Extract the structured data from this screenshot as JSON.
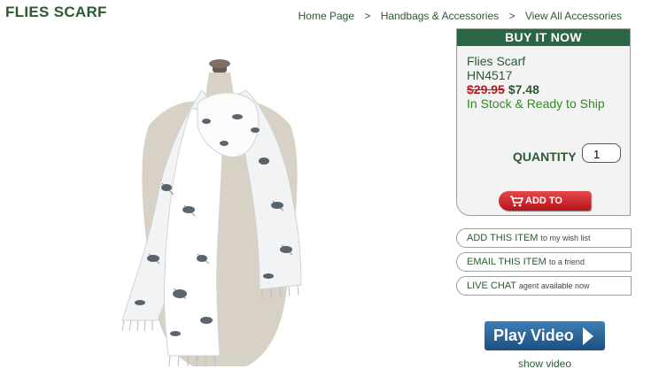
{
  "page": {
    "title": "FLIES SCARF"
  },
  "breadcrumb": {
    "items": [
      "Home Page",
      "Handbags & Accessories",
      "View All Accessories"
    ],
    "separator": ">"
  },
  "buy_box": {
    "header": "BUY IT NOW",
    "product_name": "Flies Scarf",
    "sku": "HN4517",
    "old_price": "$29.95",
    "new_price": "$7.48",
    "stock_status": "In Stock & Ready to Ship",
    "quantity_label": "QUANTITY",
    "quantity_value": "1",
    "add_to_cart_label": "ADD TO CART"
  },
  "links": {
    "wish_main": "ADD THIS ITEM",
    "wish_sub": "to my wish list",
    "email_main": "EMAIL THIS ITEM",
    "email_sub": "to a friend",
    "chat_main": "LIVE CHAT",
    "chat_sub": "agent available now"
  },
  "video": {
    "button_label": "Play Video",
    "caption": "show video"
  },
  "icons": {
    "cart": "cart-icon",
    "play": "play-arrow-icon"
  },
  "colors": {
    "brand_green": "#2b6644",
    "sale_red": "#c0191e",
    "video_blue": "#1b4f82"
  }
}
